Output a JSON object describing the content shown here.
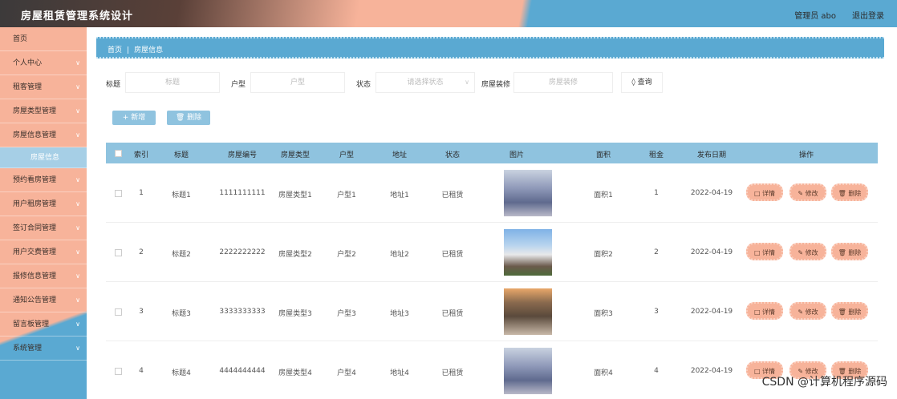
{
  "header": {
    "title": "房屋租赁管理系统设计",
    "user": "管理员 abo",
    "logout": "退出登录"
  },
  "sidebar": {
    "items": [
      {
        "label": "首页"
      },
      {
        "label": "个人中心",
        "chev": "∨"
      },
      {
        "label": "租客管理",
        "chev": "∨"
      },
      {
        "label": "房屋类型管理",
        "chev": "∨"
      },
      {
        "label": "房屋信息管理",
        "chev": "∨"
      },
      {
        "label": "房屋信息"
      },
      {
        "label": "预约看房管理",
        "chev": "∨"
      },
      {
        "label": "用户租房管理",
        "chev": "∨"
      },
      {
        "label": "签订合同管理",
        "chev": "∨"
      },
      {
        "label": "用户交费管理",
        "chev": "∨"
      },
      {
        "label": "报修信息管理",
        "chev": "∨"
      },
      {
        "label": "通知公告管理",
        "chev": "∨"
      },
      {
        "label": "留言板管理",
        "chev": "∨"
      },
      {
        "label": "系统管理",
        "chev": "∨"
      }
    ]
  },
  "breadcrumb": {
    "home": "首页",
    "sep": "|",
    "current": "房屋信息"
  },
  "search": {
    "title_label": "标题",
    "title_placeholder": "标题",
    "layout_label": "户型",
    "layout_placeholder": "户型",
    "status_label": "状态",
    "status_placeholder": "请选择状态",
    "decor_label": "房屋装修",
    "decor_placeholder": "房屋装修",
    "query_label": "◊ 查询"
  },
  "actions": {
    "add": "+ 新增",
    "delete": "🗑 删除"
  },
  "table": {
    "headers": [
      "索引",
      "标题",
      "房屋编号",
      "房屋类型",
      "户型",
      "地址",
      "状态",
      "图片",
      "面积",
      "租金",
      "发布日期",
      "操作"
    ],
    "rows": [
      [
        "1",
        "标题1",
        "1111111111",
        "房屋类型1",
        "户型1",
        "地址1",
        "已租赁",
        "",
        "面积1",
        "1",
        "2022-04-19"
      ],
      [
        "2",
        "标题2",
        "2222222222",
        "房屋类型2",
        "户型2",
        "地址2",
        "已租赁",
        "",
        "面积2",
        "2",
        "2022-04-19"
      ],
      [
        "3",
        "标题3",
        "3333333333",
        "房屋类型3",
        "户型3",
        "地址3",
        "已租赁",
        "",
        "面积3",
        "3",
        "2022-04-19"
      ],
      [
        "4",
        "标题4",
        "4444444444",
        "房屋类型4",
        "户型4",
        "地址4",
        "已租赁",
        "",
        "面积4",
        "4",
        "2022-04-19"
      ]
    ],
    "ops": {
      "detail": "□ 详情",
      "edit": "✎ 修改",
      "del": "🗑 删除"
    }
  },
  "watermark": "CSDN @计算机程序源码"
}
